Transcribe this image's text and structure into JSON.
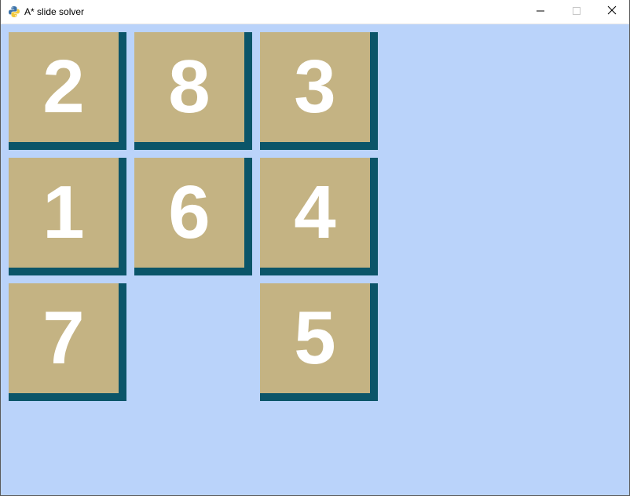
{
  "window": {
    "title": "A* slide solver",
    "icon": "python-icon",
    "controls": {
      "minimize_icon": "minimize-icon",
      "maximize_icon": "maximize-icon",
      "close_icon": "close-icon"
    }
  },
  "colors": {
    "background": "#bad3fa",
    "tile_face": "#c4b383",
    "tile_shadow": "#0b5569",
    "tile_text": "#ffffff"
  },
  "puzzle": {
    "rows": [
      [
        "2",
        "8",
        "3"
      ],
      [
        "1",
        "6",
        "4"
      ],
      [
        "7",
        "",
        "5"
      ]
    ],
    "tiles": {
      "r0c0": "2",
      "r0c1": "8",
      "r0c2": "3",
      "r1c0": "1",
      "r1c1": "6",
      "r1c2": "4",
      "r2c0": "7",
      "r2c2": "5"
    }
  }
}
